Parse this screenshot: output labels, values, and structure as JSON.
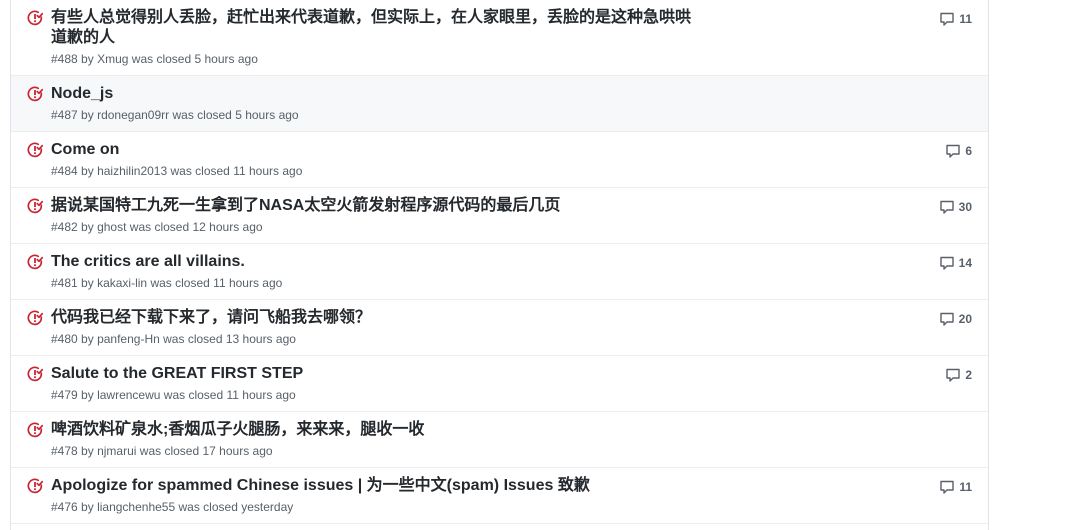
{
  "colors": {
    "closed_icon": "#cb2431",
    "title": "#24292e",
    "meta": "#586069"
  },
  "issues": [
    {
      "title": "有些人总觉得别人丢脸，赶忙出来代表道歉，但实际上，在人家眼里，丢脸的是这种急哄哄道歉的人",
      "number": "#488",
      "by": "by",
      "author": "Xmug",
      "status": "was closed",
      "time": "5 hours ago",
      "comments": "11",
      "icon": "closed-issue-icon"
    },
    {
      "title": "Node_js",
      "number": "#487",
      "by": "by",
      "author": "rdonegan09rr",
      "status": "was closed",
      "time": "5 hours ago",
      "comments": "",
      "icon": "closed-issue-icon"
    },
    {
      "title": "Come on",
      "number": "#484",
      "by": "by",
      "author": "haizhilin2013",
      "status": "was closed",
      "time": "11 hours ago",
      "comments": "6",
      "icon": "closed-issue-icon"
    },
    {
      "title": "据说某国特工九死一生拿到了NASA太空火箭发射程序源代码的最后几页",
      "number": "#482",
      "by": "by",
      "author": "ghost",
      "status": "was closed",
      "time": "12 hours ago",
      "comments": "30",
      "icon": "closed-issue-icon"
    },
    {
      "title": "The critics are all villains.",
      "number": "#481",
      "by": "by",
      "author": "kakaxi-lin",
      "status": "was closed",
      "time": "11 hours ago",
      "comments": "14",
      "icon": "closed-issue-icon"
    },
    {
      "title": "代码我已经下载下来了，请问飞船我去哪领？",
      "number": "#480",
      "by": "by",
      "author": "panfeng-Hn",
      "status": "was closed",
      "time": "13 hours ago",
      "comments": "20",
      "icon": "closed-issue-icon"
    },
    {
      "title": "Salute to the GREAT FIRST STEP",
      "number": "#479",
      "by": "by",
      "author": "lawrencewu",
      "status": "was closed",
      "time": "11 hours ago",
      "comments": "2",
      "icon": "closed-issue-icon"
    },
    {
      "title": "啤酒饮料矿泉水;香烟瓜子火腿肠，来来来，腿收一收",
      "number": "#478",
      "by": "by",
      "author": "njmarui",
      "status": "was closed",
      "time": "17 hours ago",
      "comments": "",
      "icon": "closed-issue-icon"
    },
    {
      "title": "Apologize for spammed Chinese issues | 为一些中文(spam) Issues 致歉",
      "number": "#476",
      "by": "by",
      "author": "liangchenhe55",
      "status": "was closed",
      "time": "yesterday",
      "comments": "11",
      "icon": "closed-issue-icon"
    }
  ]
}
